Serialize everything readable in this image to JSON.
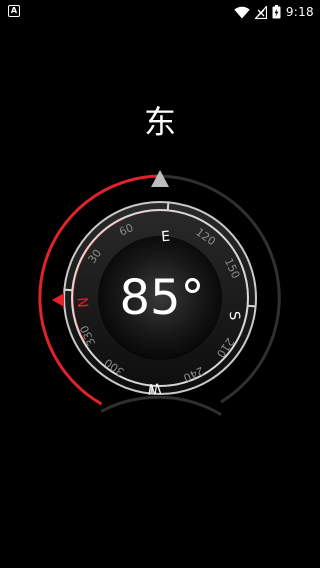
{
  "status_bar": {
    "left_icon_label": "A",
    "time": "9:18",
    "icons": [
      "wifi-icon",
      "signal-icon",
      "battery-charging-icon"
    ]
  },
  "compass": {
    "direction_label": "东",
    "heading_degrees": 85,
    "heading_text": "85°",
    "cardinals": {
      "n": "N",
      "e": "E",
      "s": "S",
      "w": "W"
    },
    "scale_numbers": [
      "30",
      "60",
      "120",
      "150",
      "210",
      "240",
      "300",
      "330"
    ],
    "accent_color": "#e0222a",
    "ring_color": "#d8d8d8"
  }
}
